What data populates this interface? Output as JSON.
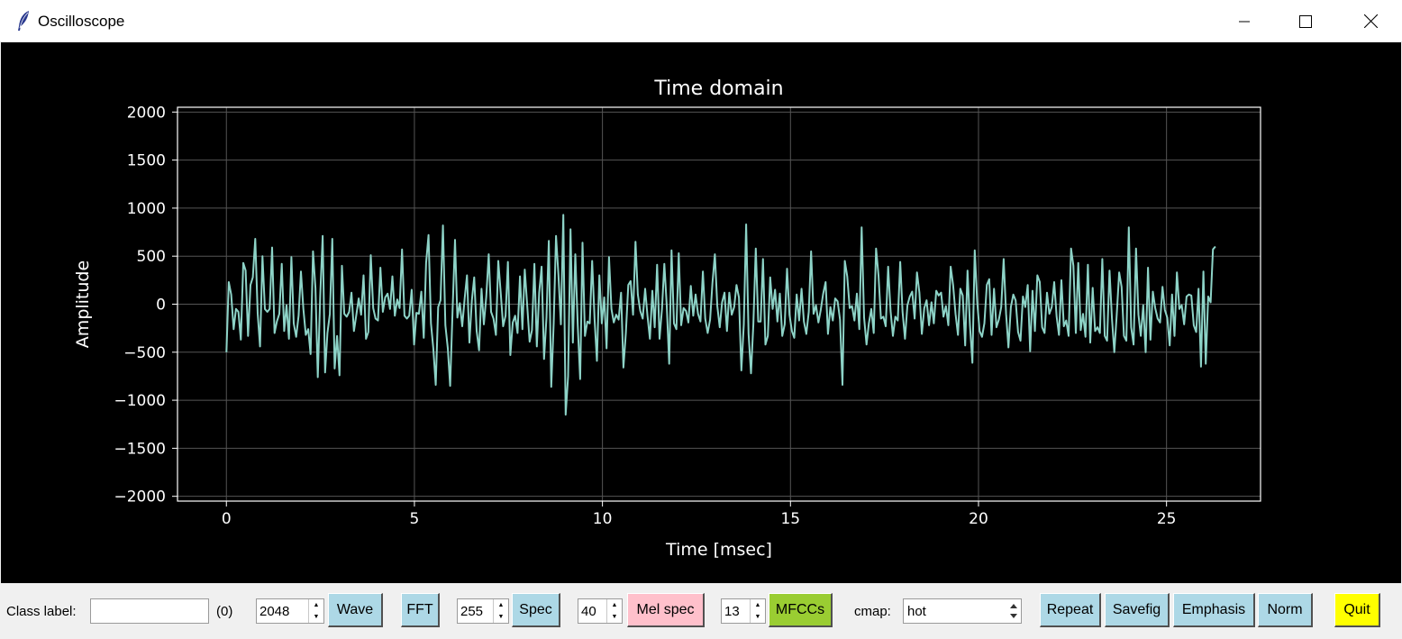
{
  "window": {
    "title": "Oscilloscope",
    "icon": "feather-icon"
  },
  "chart_data": {
    "type": "line",
    "title": "Time domain",
    "xlabel": "Time [msec]",
    "ylabel": "Amplitude",
    "xlim": [
      -1.3,
      27.5
    ],
    "ylim": [
      -2050,
      2050
    ],
    "xticks": [
      0,
      5,
      10,
      15,
      20,
      25
    ],
    "yticks": [
      2000,
      1500,
      1000,
      500,
      0,
      -500,
      -1000,
      -1500,
      -2000
    ],
    "ytick_labels": [
      "2000",
      "1500",
      "1000",
      "500",
      "0",
      "−500",
      "−1000",
      "−1500",
      "−2000"
    ],
    "grid": true,
    "background": "#000000",
    "line_color": "#8dd3c7",
    "series": [
      {
        "values": [
          -500,
          230,
          100,
          -260,
          -50,
          -80,
          -370,
          430,
          350,
          -330,
          200,
          280,
          680,
          -100,
          -440,
          500,
          -50,
          -80,
          -50,
          590,
          -300,
          -180,
          -100,
          420,
          -280,
          -10,
          -360,
          490,
          -200,
          -340,
          -120,
          340,
          -50,
          -320,
          -260,
          -520,
          550,
          170,
          -760,
          90,
          710,
          -710,
          -300,
          -100,
          680,
          -670,
          -330,
          -740,
          400,
          -100,
          -130,
          -80,
          120,
          -280,
          -110,
          60,
          -110,
          300,
          -360,
          -290,
          510,
          -40,
          -150,
          -170,
          380,
          -80,
          70,
          110,
          -50,
          290,
          -120,
          50,
          -40,
          570,
          -120,
          -150,
          -120,
          150,
          -420,
          -90,
          -100,
          130,
          -350,
          430,
          720,
          -200,
          -460,
          -840,
          -30,
          40,
          820,
          -220,
          -460,
          -850,
          -60,
          670,
          -140,
          10,
          -230,
          60,
          300,
          -400,
          40,
          280,
          -280,
          -480,
          160,
          -210,
          80,
          520,
          -80,
          -150,
          -320,
          450,
          120,
          -230,
          -120,
          440,
          -530,
          -190,
          -120,
          -300,
          290,
          -260,
          360,
          -10,
          -390,
          -270,
          420,
          -440,
          120,
          390,
          -570,
          -140,
          660,
          -860,
          -200,
          710,
          300,
          -210,
          930,
          -1150,
          -750,
          780,
          -400,
          520,
          -220,
          -780,
          640,
          -330,
          -180,
          -200,
          450,
          -160,
          -590,
          300,
          -200,
          70,
          -460,
          490,
          -50,
          -190,
          -110,
          -160,
          120,
          -660,
          -300,
          200,
          240,
          -110,
          650,
          100,
          -70,
          -150,
          160,
          -120,
          -360,
          140,
          -240,
          410,
          -360,
          -50,
          420,
          -20,
          -620,
          560,
          -200,
          -260,
          530,
          -220,
          -40,
          -70,
          -190,
          190,
          -120,
          100,
          -100,
          -180,
          340,
          -150,
          -300,
          -160,
          220,
          520,
          -20,
          -240,
          20,
          120,
          -280,
          120,
          -110,
          -30,
          200,
          70,
          -690,
          -210,
          830,
          -310,
          -720,
          -210,
          580,
          -180,
          -180,
          470,
          -420,
          -330,
          280,
          -50,
          150,
          -180,
          110,
          -330,
          -210,
          370,
          -110,
          -280,
          -350,
          100,
          -170,
          160,
          -180,
          -310,
          -80,
          550,
          -100,
          -10,
          -190,
          -60,
          110,
          230,
          -310,
          -30,
          -170,
          60,
          30,
          -160,
          -840,
          450,
          290,
          -40,
          -20,
          -170,
          110,
          -260,
          800,
          -140,
          -420,
          -200,
          -50,
          -300,
          580,
          300,
          -150,
          -130,
          -230,
          390,
          -70,
          -330,
          -130,
          -170,
          440,
          -80,
          -360,
          -10,
          80,
          130,
          -150,
          330,
          120,
          -310,
          -40,
          40,
          -220,
          20,
          -200,
          140,
          90,
          120,
          -130,
          -20,
          -220,
          390,
          200,
          -100,
          -320,
          160,
          90,
          -430,
          350,
          -220,
          -610,
          560,
          30,
          -280,
          -340,
          -200,
          200,
          260,
          -320,
          160,
          -240,
          -160,
          -30,
          470,
          -100,
          -450,
          -30,
          100,
          40,
          -290,
          -380,
          80,
          -30,
          200,
          -490,
          140,
          -280,
          300,
          230,
          -240,
          -300,
          120,
          -100,
          -30,
          230,
          -130,
          -320,
          250,
          -230,
          -170,
          -330,
          580,
          400,
          -300,
          430,
          -270,
          -100,
          -340,
          410,
          -400,
          170,
          -280,
          -240,
          -300,
          470,
          -330,
          -380,
          350,
          -150,
          -500,
          -110,
          330,
          180,
          -330,
          -380,
          800,
          -240,
          -420,
          580,
          -110,
          -330,
          -10,
          -500,
          380,
          -370,
          130,
          -40,
          -150,
          -190,
          180,
          -60,
          -140,
          -430,
          100,
          -330,
          330,
          -50,
          -10,
          -210,
          80,
          100,
          90,
          -220,
          -290,
          160,
          -650,
          340,
          -620,
          80,
          20,
          570,
          600
        ]
      }
    ]
  },
  "controls": {
    "class_label": "Class label:",
    "class_value": "",
    "class_count": "(0)",
    "wave_size": "2048",
    "wave_btn": "Wave",
    "fft_btn": "FFT",
    "spec_size": "255",
    "spec_btn": "Spec",
    "mel_size": "40",
    "mel_btn": "Mel spec",
    "mfcc_size": "13",
    "mfcc_btn": "MFCCs",
    "cmap_label": "cmap:",
    "cmap_value": "hot",
    "repeat_btn": "Repeat",
    "savefig_btn": "Savefig",
    "emphasis_btn": "Emphasis",
    "norm_btn": "Norm",
    "quit_btn": "Quit"
  },
  "colors": {
    "blue_button": "#add8e6",
    "pink_button": "#ffc0cb",
    "green_button": "#9acd32",
    "yellow_button": "#ffff00"
  }
}
